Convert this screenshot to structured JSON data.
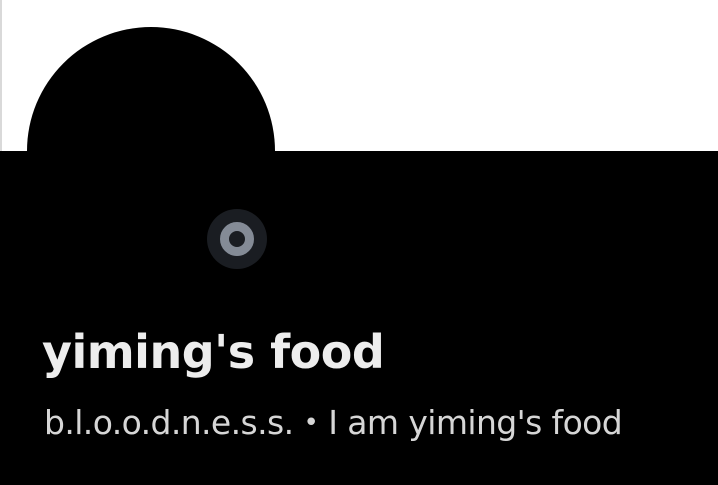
{
  "profile": {
    "display_name": "yiming's food",
    "username": "b.l.o.o.d.n.e.s.s.",
    "separator": "•",
    "status_text": "I am yiming's food"
  },
  "status": {
    "icon": "status-ring-icon",
    "ring_color": "#848b96"
  },
  "colors": {
    "banner": "#ffffff",
    "background": "#000000",
    "avatar": "#000000",
    "name_text": "#ededed",
    "subline_text": "#d6d6d6"
  }
}
